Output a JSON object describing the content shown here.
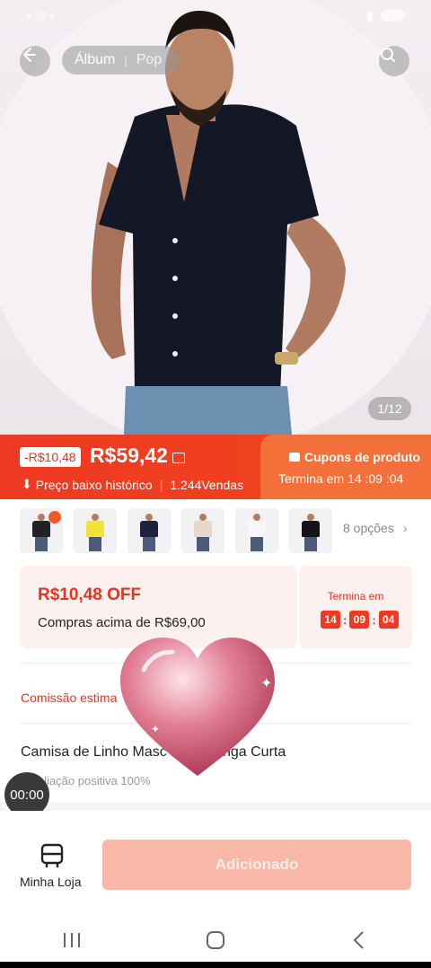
{
  "hero": {
    "album_label": "Álbum",
    "pop_label": "Pop",
    "image_counter": "1/12"
  },
  "price_banner": {
    "discount": "-R$10,48",
    "price": "R$59,42",
    "historical_low": "Preço baixo histórico",
    "sales": "1.244Vendas",
    "coupon_title": "Cupons de produto",
    "coupon_timer": "Termina em 14 :09 :04"
  },
  "variants": {
    "count": 6,
    "shirt_colors": [
      "#222222",
      "#f2e23a",
      "#1c2240",
      "#e8d8cc",
      "#f7f7f7",
      "#141418"
    ],
    "more_options": "8 opções"
  },
  "coupon": {
    "amount_off": "R$10,48 OFF",
    "min_purchase": "Compras acima de R$69,00",
    "ends_label": "Termina em",
    "hours": "14",
    "minutes": "09",
    "seconds": "04"
  },
  "commission_label": "Comissão estima",
  "product_title": "Camisa de Linho Masc        n Fit Manga Curta",
  "rating": "Avaliação positiva 100%",
  "record_timer": "00:00",
  "bottom": {
    "store_label": "Minha Loja",
    "add_button": "Adicionado"
  },
  "colors": {
    "accent": "#ee3a22",
    "accent_light": "#f4703b",
    "button_disabled": "#f9b8a7"
  }
}
